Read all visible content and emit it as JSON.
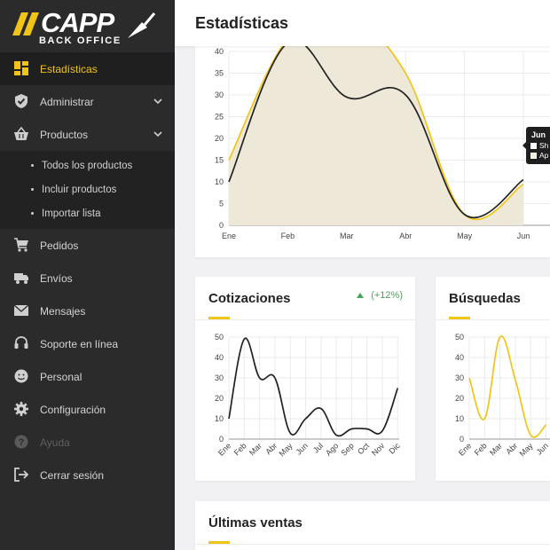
{
  "brand": {
    "name": "CAPP",
    "subtitle": "BACK OFFICE",
    "accent": "#f0c518"
  },
  "sidebar": {
    "items": [
      {
        "label": "Estadísticas",
        "icon": "dashboard-icon",
        "active": true
      },
      {
        "label": "Administrar",
        "icon": "shield-check-icon",
        "expandable": true
      },
      {
        "label": "Productos",
        "icon": "basket-icon",
        "expandable": true,
        "expanded": true
      },
      {
        "label": "Pedidos",
        "icon": "cart-icon"
      },
      {
        "label": "Envíos",
        "icon": "truck-icon"
      },
      {
        "label": "Mensajes",
        "icon": "envelope-icon"
      },
      {
        "label": "Soporte en línea",
        "icon": "headset-icon"
      },
      {
        "label": "Personal",
        "icon": "smiley-icon"
      },
      {
        "label": "Configuración",
        "icon": "gear-icon"
      },
      {
        "label": "Ayuda",
        "icon": "question-icon",
        "disabled": true
      },
      {
        "label": "Cerrar sesión",
        "icon": "logout-icon"
      }
    ],
    "productos_sub": [
      {
        "label": "Todos los productos"
      },
      {
        "label": "Incluir productos"
      },
      {
        "label": "Importar lista"
      }
    ]
  },
  "header": {
    "title": "Estadísticas"
  },
  "cards": {
    "quotes": {
      "title": "Cotizaciones",
      "trend": "(+12%)"
    },
    "searches": {
      "title": "Búsquedas"
    },
    "sales": {
      "title": "Últimas ventas"
    }
  },
  "tooltip": {
    "title": "Jun",
    "rows": [
      {
        "label": "Sh",
        "color": "#ffffff"
      },
      {
        "label": "Ap",
        "color": "#f5eed0"
      }
    ]
  },
  "chart_data": [
    {
      "type": "area",
      "categories": [
        "Ene",
        "Feb",
        "Mar",
        "Abr",
        "May",
        "Jun"
      ],
      "ylim": [
        0,
        40
      ],
      "yticks": [
        0,
        5,
        10,
        15,
        20,
        25,
        30,
        35,
        40
      ],
      "series": [
        {
          "color": "#222222",
          "values": [
            10,
            42,
            29.5,
            30,
            2.5,
            10.5
          ]
        },
        {
          "color": "#f0c518",
          "fill": "#ede8d8",
          "values": [
            15,
            43,
            48,
            35,
            2.5,
            9.5
          ]
        }
      ],
      "grid": true
    },
    {
      "type": "line",
      "categories": [
        "Ene",
        "Feb",
        "Mar",
        "Abr",
        "May",
        "Jun",
        "Jul",
        "Ago",
        "Sep",
        "Oct",
        "Nov",
        "Dic"
      ],
      "ylim": [
        0,
        50
      ],
      "yticks": [
        0,
        10,
        20,
        30,
        40,
        50
      ],
      "series": [
        {
          "color": "#222222",
          "values": [
            10,
            49,
            30,
            30,
            3,
            10,
            15,
            2,
            5,
            5,
            4,
            25
          ]
        }
      ],
      "grid": true
    },
    {
      "type": "line",
      "categories": [
        "Ene",
        "Feb",
        "Mar",
        "Abr",
        "May",
        "Jun"
      ],
      "ylim": [
        0,
        50
      ],
      "yticks": [
        0,
        10,
        20,
        30,
        40,
        50
      ],
      "series": [
        {
          "color": "#f0c518",
          "values": [
            30,
            10,
            50,
            29,
            2,
            7
          ]
        }
      ],
      "grid": true
    }
  ]
}
